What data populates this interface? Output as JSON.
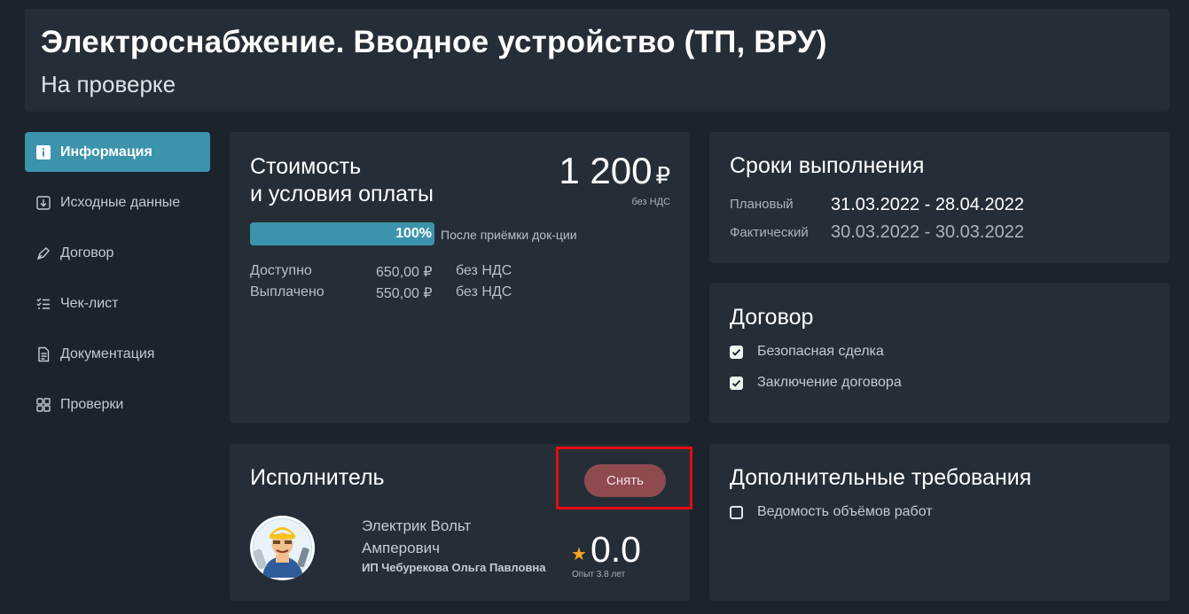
{
  "header": {
    "title": "Электроснабжение. Вводное устройство (ТП, ВРУ)",
    "status": "На проверке"
  },
  "sidebar": {
    "items": [
      {
        "label": "Информация",
        "icon": "info-icon",
        "active": true
      },
      {
        "label": "Исходные данные",
        "icon": "download-icon",
        "active": false
      },
      {
        "label": "Договор",
        "icon": "pen-icon",
        "active": false
      },
      {
        "label": "Чек-лист",
        "icon": "checklist-icon",
        "active": false
      },
      {
        "label": "Документация",
        "icon": "document-icon",
        "active": false
      },
      {
        "label": "Проверки",
        "icon": "grid-icon",
        "active": false
      }
    ]
  },
  "cost": {
    "title_line1": "Стоимость",
    "title_line2": "и условия оплаты",
    "price": "1 200",
    "currency": "₽",
    "price_note": "без НДС",
    "progress_value": 100,
    "progress_label": "100%",
    "progress_note": "После приёмки док-ции",
    "rows": [
      {
        "label": "Доступно",
        "amount": "650,00 ₽",
        "vat": "без НДС"
      },
      {
        "label": "Выплачено",
        "amount": "550,00 ₽",
        "vat": "без НДС"
      }
    ]
  },
  "deadlines": {
    "title": "Сроки выполнения",
    "planned_label": "Плановый",
    "planned_value": "31.03.2022 - 28.04.2022",
    "actual_label": "Фактический",
    "actual_value": "30.03.2022 - 30.03.2022"
  },
  "contract": {
    "title": "Договор",
    "items": [
      {
        "label": "Безопасная сделка",
        "checked": true
      },
      {
        "label": "Заключение договора",
        "checked": true
      }
    ]
  },
  "executor": {
    "title": "Исполнитель",
    "remove_label": "Снять",
    "name": "Электрик Вольт Амперович",
    "org": "ИП Чебурекова Ольга Павловна",
    "rating": "0.0",
    "experience": "Опыт 3.8 лет"
  },
  "extra": {
    "title": "Дополнительные требования",
    "items": [
      {
        "label": "Ведомость объёмов работ",
        "checked": false
      }
    ]
  },
  "colors": {
    "accent": "#3c93ac",
    "danger_button": "#8f4a50",
    "highlight": "#e50b14",
    "star": "#f5a623"
  }
}
